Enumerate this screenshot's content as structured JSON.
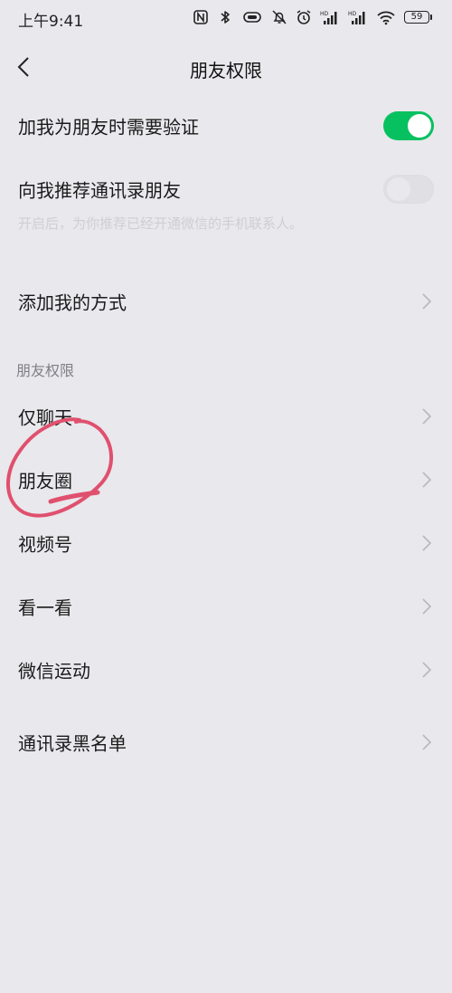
{
  "status_bar": {
    "time": "上午9:41",
    "battery": "59",
    "icons": [
      "nfc-icon",
      "bluetooth-icon",
      "vibrate-icon",
      "mute-icon",
      "alarm-icon",
      "signal-hd-icon",
      "signal-hd-icon",
      "wifi-icon",
      "battery-icon"
    ]
  },
  "nav": {
    "title": "朋友权限",
    "back_icon": "chevron-left-icon"
  },
  "settings": {
    "verify_on_add": {
      "label": "加我为朋友时需要验证",
      "enabled": true
    },
    "recommend_contacts": {
      "label": "向我推荐通讯录朋友",
      "enabled": false,
      "hint": "开启后，为你推荐已经开通微信的手机联系人。"
    },
    "add_methods": {
      "label": "添加我的方式"
    }
  },
  "friend_permissions": {
    "section_title": "朋友权限",
    "items": [
      {
        "label": "仅聊天"
      },
      {
        "label": "朋友圈"
      },
      {
        "label": "视频号"
      },
      {
        "label": "看一看"
      },
      {
        "label": "微信运动"
      }
    ]
  },
  "blocklist": {
    "label": "通讯录黑名单"
  },
  "colors": {
    "background": "#e9e8ec",
    "toggle_on": "#07c160",
    "annotation": "#e0506e",
    "chevron": "#b8b7c0"
  }
}
